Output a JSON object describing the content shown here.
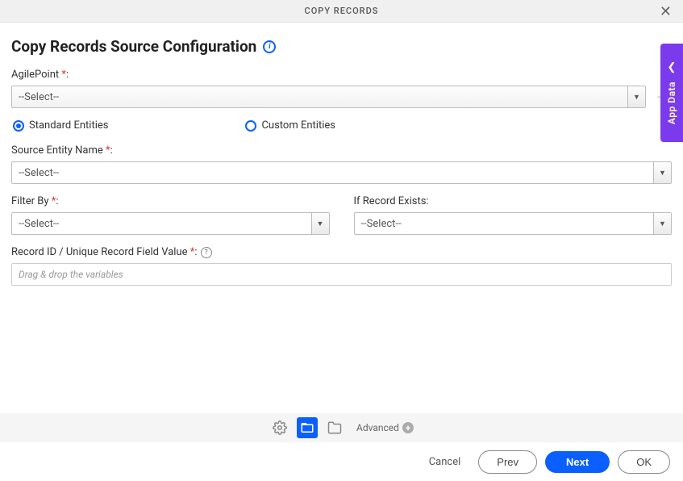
{
  "header": {
    "title": "COPY RECORDS"
  },
  "page_title": "Copy Records Source Configuration",
  "fields": {
    "agilepoint": {
      "label": "AgilePoint",
      "value": "--Select--"
    },
    "entity_type": {
      "standard": "Standard Entities",
      "custom": "Custom Entities",
      "selected": "standard"
    },
    "source_entity": {
      "label": "Source Entity Name",
      "value": "--Select--"
    },
    "filter_by": {
      "label": "Filter By",
      "value": "--Select--"
    },
    "if_record_exists": {
      "label": "If Record Exists:",
      "value": "--Select--"
    },
    "record_id": {
      "label": "Record ID / Unique Record Field Value",
      "placeholder": "Drag & drop the variables"
    }
  },
  "side_tab": {
    "label": "App Data"
  },
  "toolbar": {
    "advanced": "Advanced"
  },
  "footer": {
    "cancel": "Cancel",
    "prev": "Prev",
    "next": "Next",
    "ok": "OK"
  }
}
